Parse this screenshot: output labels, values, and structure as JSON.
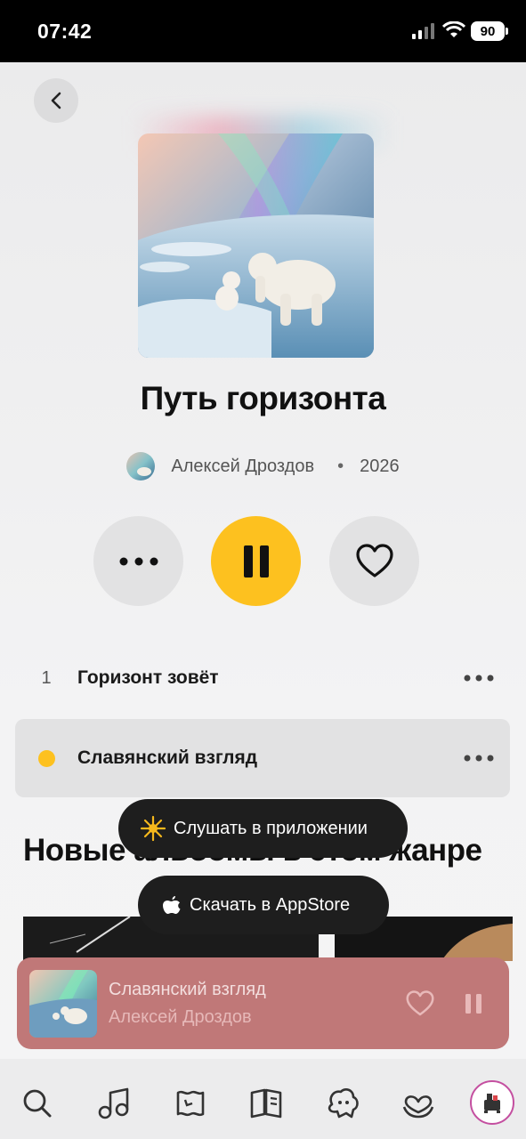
{
  "status_bar": {
    "time": "07:42",
    "battery": "90"
  },
  "album": {
    "title": "Путь горизонта",
    "artist": "Алексей Дроздов",
    "year": "2026"
  },
  "tracks": [
    {
      "number": "1",
      "title": "Горизонт зовёт",
      "playing": false
    },
    {
      "number": "",
      "title": "Славянский взгляд",
      "playing": true
    }
  ],
  "section": {
    "title": "Новые альбомы в этом жанре"
  },
  "overlay": {
    "open_in_app_label": "Слушать в приложении",
    "download_label": "Скачать в AppStore"
  },
  "mini_player": {
    "title": "Славянский взгляд",
    "artist": "Алексей Дроздов"
  },
  "bottom_nav": {
    "items": [
      "search-icon",
      "music-note-icon",
      "map-icon",
      "book-icon",
      "kids-icon",
      "heart-hands-icon",
      "profile-avatar"
    ]
  },
  "colors": {
    "accent": "#fdc11f",
    "player_bg": "#c07878",
    "pill_bg": "#1e1e1e",
    "profile_ring": "#c44fa0"
  }
}
